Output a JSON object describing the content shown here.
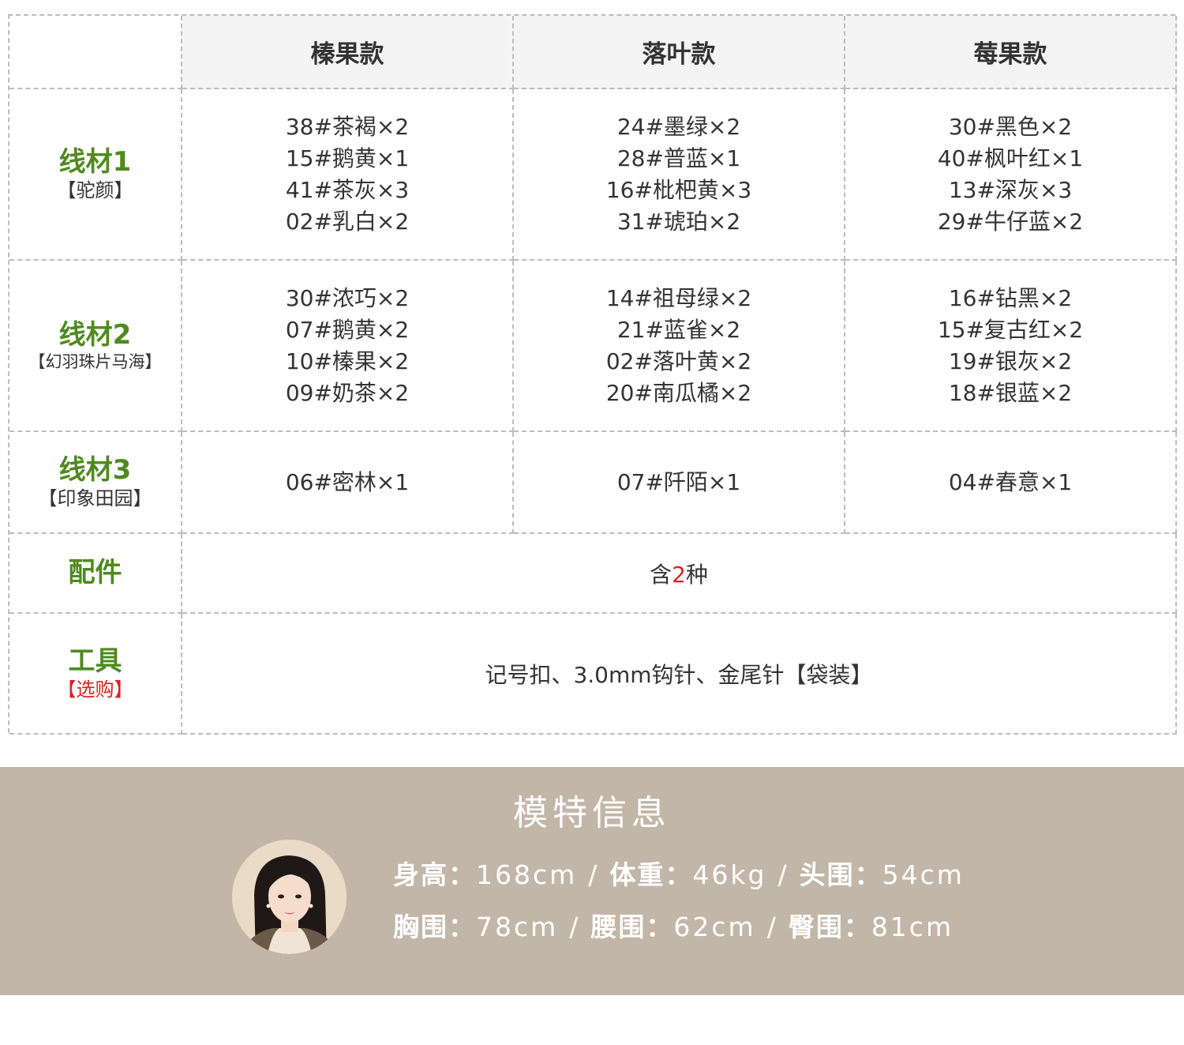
{
  "table": {
    "headers": [
      "",
      "榛果款",
      "落叶款",
      "莓果款"
    ],
    "rows": [
      {
        "label": "线材1",
        "sub": "【驼颜】",
        "cols": [
          [
            "38#茶褐×2",
            "15#鹅黄×1",
            "41#茶灰×3",
            "02#乳白×2"
          ],
          [
            "24#墨绿×2",
            "28#普蓝×1",
            "16#枇杷黄×3",
            "31#琥珀×2"
          ],
          [
            "30#黑色×2",
            "40#枫叶红×1",
            "13#深灰×3",
            "29#牛仔蓝×2"
          ]
        ]
      },
      {
        "label": "线材2",
        "sub": "【幻羽珠片马海】",
        "cols": [
          [
            "30#浓巧×2",
            "07#鹅黄×2",
            "10#榛果×2",
            "09#奶茶×2"
          ],
          [
            "14#祖母绿×2",
            "21#蓝雀×2",
            "02#落叶黄×2",
            "20#南瓜橘×2"
          ],
          [
            "16#钻黑×2",
            "15#复古红×2",
            "19#银灰×2",
            "18#银蓝×2"
          ]
        ]
      },
      {
        "label": "线材3",
        "sub": "【印象田园】",
        "cols": [
          [
            "06#密林×1"
          ],
          [
            "07#阡陌×1"
          ],
          [
            "04#春意×1"
          ]
        ]
      }
    ],
    "accessories": {
      "label": "配件",
      "value_prefix": "含",
      "value_num": "2",
      "value_suffix": "种"
    },
    "tools": {
      "label": "工具",
      "sub": "【选购】",
      "value": "记号扣、3.0mm钩针、金尾针【袋装】"
    }
  },
  "model": {
    "title": "模特信息",
    "height_key": "身高：",
    "height_val": "168cm",
    "weight_key": "体重：",
    "weight_val": "46kg",
    "head_key": "头围：",
    "head_val": "54cm",
    "chest_key": "胸围：",
    "chest_val": "78cm",
    "waist_key": "腰围：",
    "waist_val": "62cm",
    "hip_key": "臀围：",
    "hip_val": "81cm",
    "separator": "/"
  },
  "colors": {
    "accent_green": "#4f8a1f",
    "accent_red": "#e02020",
    "banner_bg": "#c2b6a8"
  }
}
